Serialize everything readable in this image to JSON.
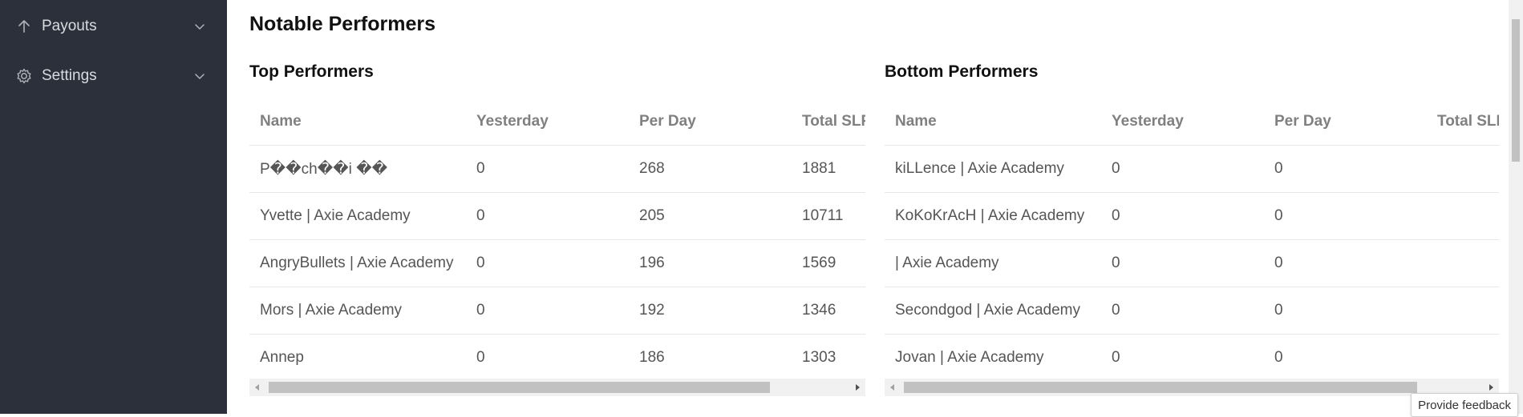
{
  "sidebar": {
    "items": [
      {
        "label": "Payouts",
        "icon": "arrow-up-icon"
      },
      {
        "label": "Settings",
        "icon": "gear-icon"
      }
    ]
  },
  "page_title": "Notable Performers",
  "top": {
    "title": "Top Performers",
    "columns": [
      "Name",
      "Yesterday",
      "Per Day",
      "Total SLP"
    ],
    "rows": [
      [
        "P��ch��i ��",
        "0",
        "268",
        "1881"
      ],
      [
        "Yvette | Axie Academy",
        "0",
        "205",
        "10711"
      ],
      [
        "AngryBullets | Axie Academy",
        "0",
        "196",
        "1569"
      ],
      [
        "Mors | Axie Academy",
        "0",
        "192",
        "1346"
      ],
      [
        "Annep",
        "0",
        "186",
        "1303"
      ]
    ]
  },
  "bottom": {
    "title": "Bottom Performers",
    "columns": [
      "Name",
      "Yesterday",
      "Per Day",
      "Total SLP"
    ],
    "rows": [
      [
        "kiLLence | Axie Academy",
        "0",
        "0",
        ""
      ],
      [
        "KoKoKrAcH | Axie Academy",
        "0",
        "0",
        ""
      ],
      [
        "| Axie Academy",
        "0",
        "0",
        ""
      ],
      [
        "Secondgod | Axie Academy",
        "0",
        "0",
        ""
      ],
      [
        "Jovan | Axie Academy",
        "0",
        "0",
        ""
      ]
    ]
  },
  "feedback_label": "Provide feedback"
}
